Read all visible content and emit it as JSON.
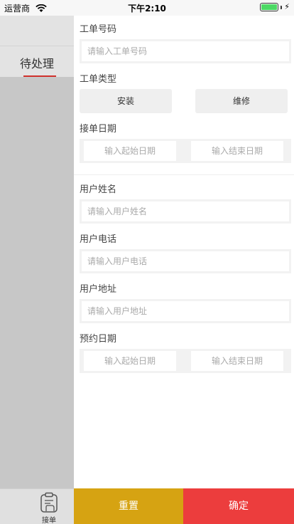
{
  "status_bar": {
    "carrier": "运营商",
    "time": "下午2:10"
  },
  "sidebar": {
    "active_tab": "待处理"
  },
  "bottom_tab": {
    "label": "接单"
  },
  "form": {
    "work_order_no": {
      "label": "工单号码",
      "placeholder": "请输入工单号码"
    },
    "work_order_type": {
      "label": "工单类型",
      "options": [
        "安装",
        "维修"
      ]
    },
    "accept_date": {
      "label": "接单日期",
      "start_placeholder": "输入起始日期",
      "end_placeholder": "输入结束日期"
    },
    "user_name": {
      "label": "用户姓名",
      "placeholder": "请输入用户姓名"
    },
    "user_phone": {
      "label": "用户电话",
      "placeholder": "请输入用户电话"
    },
    "user_address": {
      "label": "用户地址",
      "placeholder": "请输入用户地址"
    },
    "appointment_date": {
      "label": "预约日期",
      "start_placeholder": "输入起始日期",
      "end_placeholder": "输入结束日期"
    }
  },
  "actions": {
    "reset": "重置",
    "confirm": "确定"
  },
  "colors": {
    "accent_red": "#ec3d3d",
    "reset_yellow": "#d6a312",
    "tab_underline": "#d0312d",
    "battery_green": "#4cd964"
  }
}
